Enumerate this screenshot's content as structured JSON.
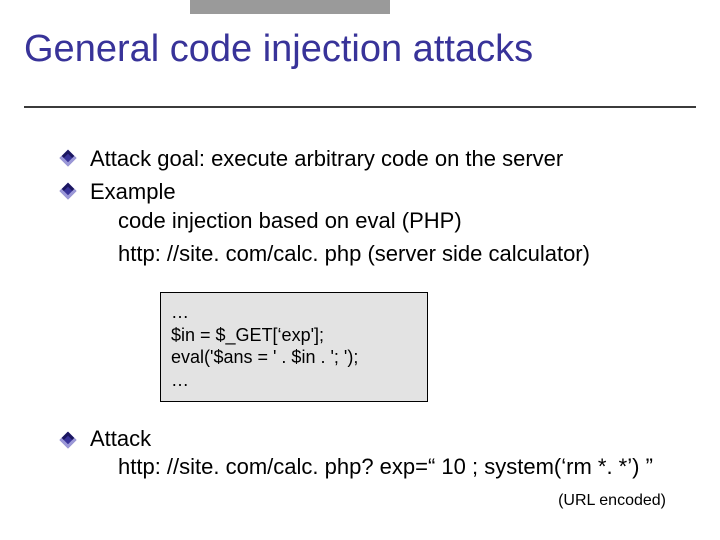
{
  "title": "General code injection attacks",
  "bullets": {
    "b1": "Attack goal: execute arbitrary code on the server",
    "b2": "Example",
    "b2_sub1": "code injection based on eval   (PHP)",
    "b2_sub2": "http: //site. com/calc. php         (server side calculator)",
    "b3": "Attack",
    "b3_sub1": "http: //site. com/calc. php? exp=“ 10 ; system(‘rm *. *’) ”"
  },
  "code": {
    "l1": "…",
    "l2": "$in = $_GET[‘exp'];",
    "l3": "eval('$ans = ' . $in . '; ');",
    "l4": "…"
  },
  "url_encoded_note": "(URL encoded)"
}
